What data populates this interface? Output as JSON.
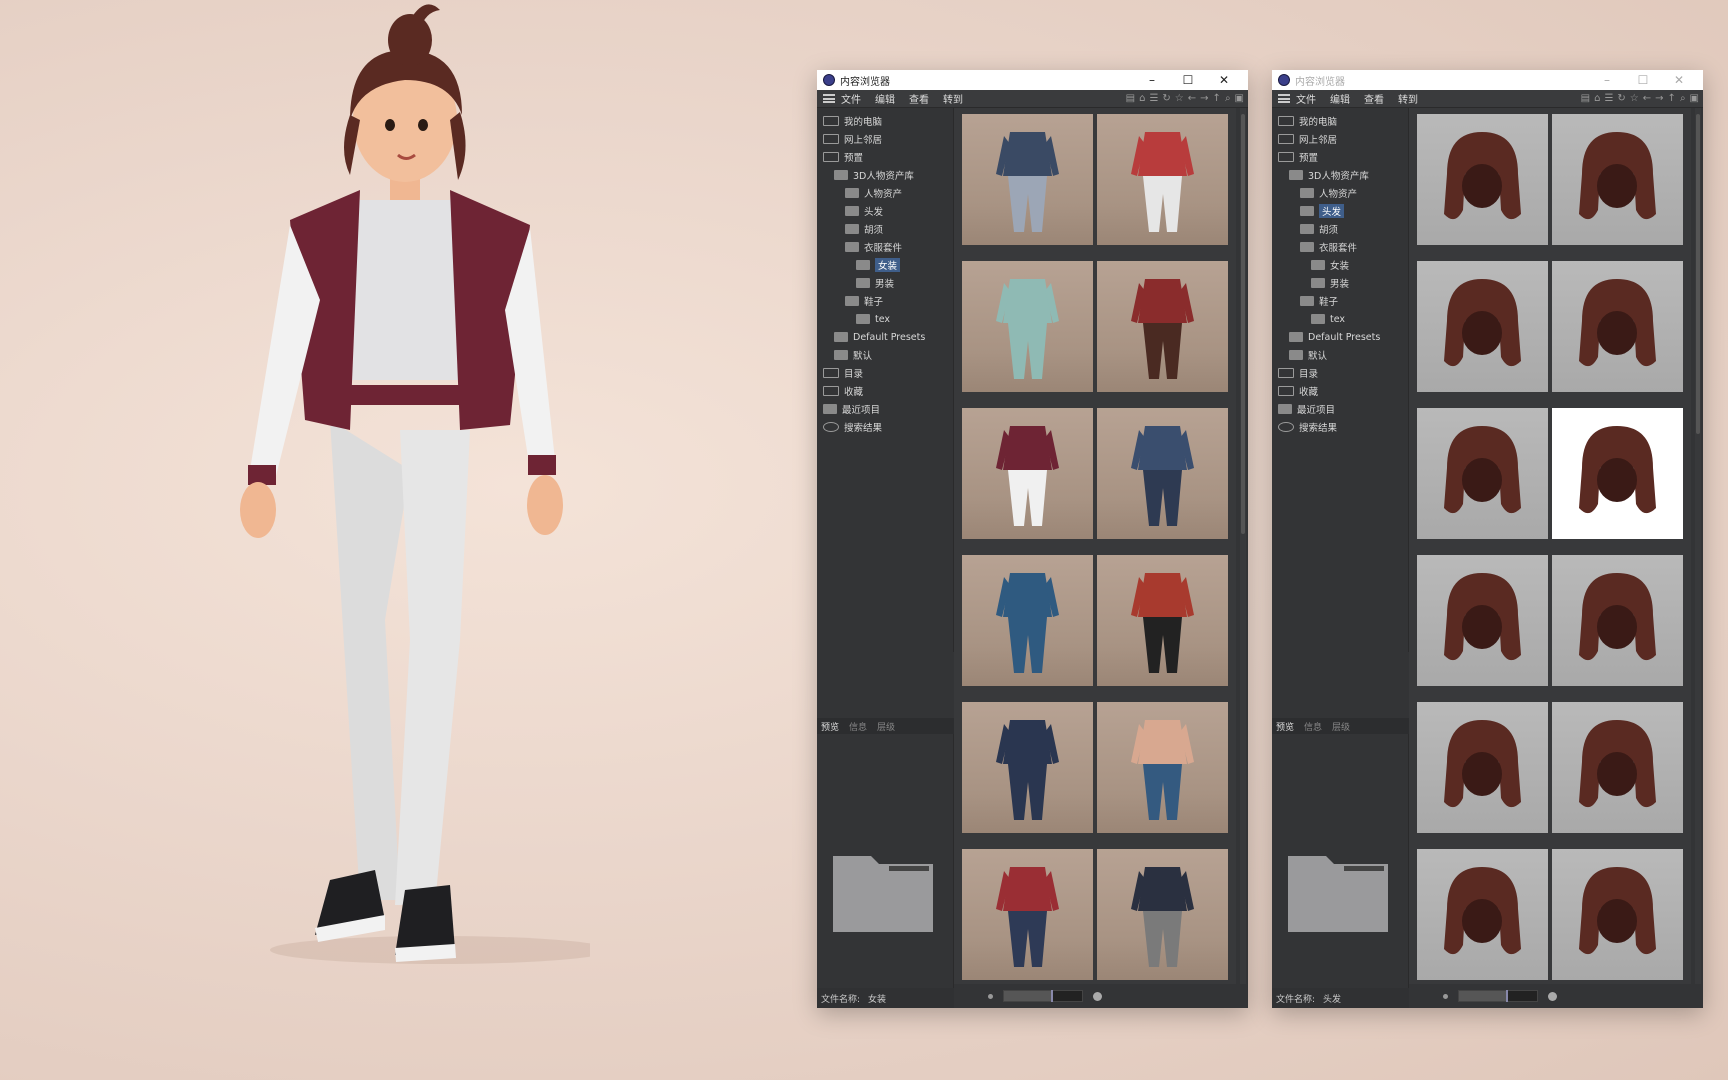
{
  "left_window": {
    "title": "内容浏览器",
    "menu": [
      "文件",
      "编辑",
      "查看",
      "转到"
    ],
    "tree": [
      {
        "label": "我的电脑",
        "depth": 1,
        "icon": "computer-icon"
      },
      {
        "label": "网上邻居",
        "depth": 1,
        "icon": "network-icon"
      },
      {
        "label": "预置",
        "depth": 1,
        "icon": "preset-icon"
      },
      {
        "label": "3D人物资产库",
        "depth": 2,
        "icon": "folder-open-icon"
      },
      {
        "label": "人物资产",
        "depth": 3,
        "icon": "folder-icon"
      },
      {
        "label": "头发",
        "depth": 3,
        "icon": "folder-icon"
      },
      {
        "label": "胡须",
        "depth": 3,
        "icon": "folder-icon"
      },
      {
        "label": "衣服套件",
        "depth": 3,
        "icon": "folder-open-icon"
      },
      {
        "label": "女装",
        "depth": 4,
        "icon": "folder-icon",
        "selected": true
      },
      {
        "label": "男装",
        "depth": 4,
        "icon": "folder-icon"
      },
      {
        "label": "鞋子",
        "depth": 3,
        "icon": "folder-open-icon"
      },
      {
        "label": "tex",
        "depth": 4,
        "icon": "folder-icon"
      },
      {
        "label": "Default Presets",
        "depth": 2,
        "icon": "folder-icon"
      },
      {
        "label": "默认",
        "depth": 2,
        "icon": "folder-icon"
      },
      {
        "label": "目录",
        "depth": 1,
        "icon": "catalog-icon"
      },
      {
        "label": "收藏",
        "depth": 1,
        "icon": "star-icon"
      },
      {
        "label": "最近项目",
        "depth": 1,
        "icon": "folder-icon"
      },
      {
        "label": "搜索结果",
        "depth": 1,
        "icon": "search-icon"
      }
    ],
    "preview_tabs": [
      "预览",
      "信息",
      "层级"
    ],
    "status_label": "文件名称:",
    "status_value": "女装",
    "thumb_kind": "cloth",
    "thumb_count": 12,
    "zoom_level": 0.6
  },
  "right_window": {
    "title": "内容浏览器",
    "menu": [
      "文件",
      "编辑",
      "查看",
      "转到"
    ],
    "tree": [
      {
        "label": "我的电脑",
        "depth": 1,
        "icon": "computer-icon"
      },
      {
        "label": "网上邻居",
        "depth": 1,
        "icon": "network-icon"
      },
      {
        "label": "预置",
        "depth": 1,
        "icon": "preset-icon"
      },
      {
        "label": "3D人物资产库",
        "depth": 2,
        "icon": "folder-open-icon"
      },
      {
        "label": "人物资产",
        "depth": 3,
        "icon": "folder-icon"
      },
      {
        "label": "头发",
        "depth": 3,
        "icon": "folder-icon",
        "selected": true
      },
      {
        "label": "胡须",
        "depth": 3,
        "icon": "folder-icon"
      },
      {
        "label": "衣服套件",
        "depth": 3,
        "icon": "folder-open-icon"
      },
      {
        "label": "女装",
        "depth": 4,
        "icon": "folder-icon"
      },
      {
        "label": "男装",
        "depth": 4,
        "icon": "folder-icon"
      },
      {
        "label": "鞋子",
        "depth": 3,
        "icon": "folder-open-icon"
      },
      {
        "label": "tex",
        "depth": 4,
        "icon": "folder-icon"
      },
      {
        "label": "Default Presets",
        "depth": 2,
        "icon": "folder-icon"
      },
      {
        "label": "默认",
        "depth": 2,
        "icon": "folder-icon"
      },
      {
        "label": "目录",
        "depth": 1,
        "icon": "catalog-icon"
      },
      {
        "label": "收藏",
        "depth": 1,
        "icon": "star-icon"
      },
      {
        "label": "最近项目",
        "depth": 1,
        "icon": "folder-icon"
      },
      {
        "label": "搜索结果",
        "depth": 1,
        "icon": "search-icon"
      }
    ],
    "preview_tabs": [
      "预览",
      "信息",
      "层级"
    ],
    "status_label": "文件名称:",
    "status_value": "头发",
    "thumb_kind": "hair",
    "thumb_count": 12,
    "selected_thumb": 5,
    "zoom_level": 0.6
  },
  "colors": {
    "selection": "#3f5e8a",
    "panel_bg": "#333436",
    "grid_bg": "#38393b",
    "jacket": "#6e2434",
    "hair": "#5a2a22"
  }
}
